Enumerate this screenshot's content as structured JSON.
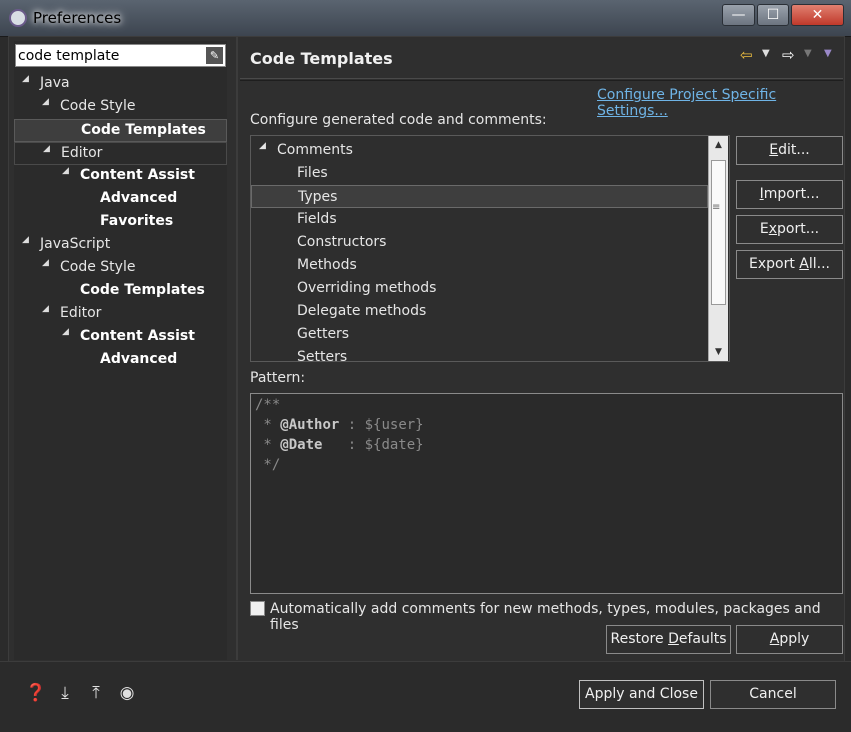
{
  "window": {
    "title": "Preferences",
    "min_label": "—",
    "max_label": "☐",
    "close_label": "✕"
  },
  "filter": {
    "value": "code template",
    "clear_icon": "✎"
  },
  "tree": [
    {
      "label": "Java",
      "level": 0,
      "expanded": true,
      "bold": false
    },
    {
      "label": "Code Style",
      "level": 1,
      "expanded": true,
      "bold": false
    },
    {
      "label": "Code Templates",
      "level": 2,
      "bold": true,
      "selected": true
    },
    {
      "label": "Editor",
      "level": 1,
      "expanded": true,
      "bold": false
    },
    {
      "label": "Content Assist",
      "level": 2,
      "expanded": true,
      "bold": true
    },
    {
      "label": "Advanced",
      "level": 3,
      "bold": true
    },
    {
      "label": "Favorites",
      "level": 3,
      "bold": true
    },
    {
      "label": "JavaScript",
      "level": 0,
      "expanded": true,
      "bold": false
    },
    {
      "label": "Code Style",
      "level": 1,
      "expanded": true,
      "bold": false
    },
    {
      "label": "Code Templates",
      "level": 2,
      "bold": true
    },
    {
      "label": "Editor",
      "level": 1,
      "expanded": true,
      "bold": false
    },
    {
      "label": "Content Assist",
      "level": 2,
      "expanded": true,
      "bold": true
    },
    {
      "label": "Advanced",
      "level": 3,
      "bold": true
    }
  ],
  "page": {
    "title": "Code Templates",
    "project_link": "Configure Project Specific Settings...",
    "configure_label": "Configure generated code and comments:",
    "pattern_label": "Pattern:"
  },
  "templates": [
    {
      "label": "Comments",
      "group": true
    },
    {
      "label": "Files"
    },
    {
      "label": "Types",
      "selected": true
    },
    {
      "label": "Fields"
    },
    {
      "label": "Constructors"
    },
    {
      "label": "Methods"
    },
    {
      "label": "Overriding methods"
    },
    {
      "label": "Delegate methods"
    },
    {
      "label": "Getters"
    },
    {
      "label": "Setters"
    }
  ],
  "side_buttons": {
    "edit": "Edit...",
    "import": "Import...",
    "export": "Export...",
    "export_all": "Export All..."
  },
  "pattern": {
    "line1": "/**",
    "line2_prefix": " * ",
    "line2_tag": "@Author",
    "line2_rest": " : ${user}",
    "line3_prefix": " * ",
    "line3_tag": "@Date",
    "line3_rest": "   : ${date}",
    "line4": " */"
  },
  "auto_comments": {
    "label": "Automatically add comments for new methods, types, modules, packages and files",
    "checked": false
  },
  "buttons": {
    "restore_defaults": "Restore Defaults",
    "apply": "Apply",
    "apply_and_close": "Apply and Close",
    "cancel": "Cancel"
  },
  "footer_icons": [
    "help-icon",
    "import-icon",
    "export-icon",
    "record-icon"
  ],
  "colors": {
    "link": "#6fb4e6",
    "nav_arrow": "#f0c040",
    "background": "#2f2f2f"
  }
}
